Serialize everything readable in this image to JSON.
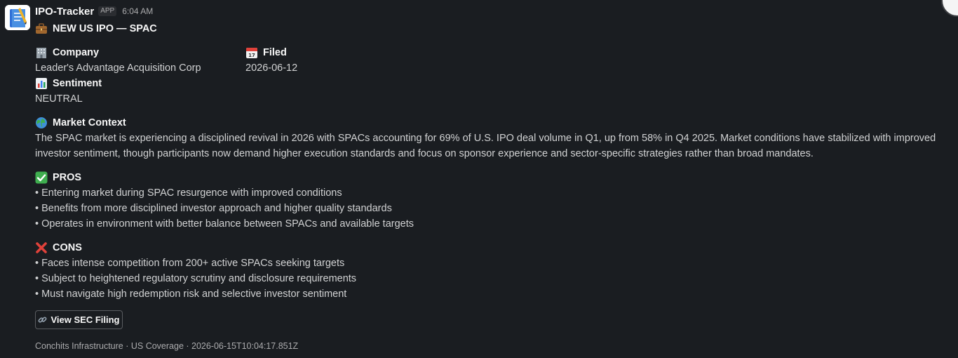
{
  "header": {
    "app_name": "IPO-Tracker",
    "badge": "APP",
    "time": "6:04 AM"
  },
  "title": {
    "icon": "briefcase-icon",
    "text": "NEW US IPO — SPAC"
  },
  "fields": {
    "company": {
      "icon": "office-building-icon",
      "label": "Company",
      "value": "Leader's Advantage Acquisition Corp"
    },
    "filed": {
      "icon": "calendar-icon",
      "label": "Filed",
      "value": "2026-06-12"
    },
    "sentiment": {
      "icon": "bar-chart-icon",
      "label": "Sentiment",
      "value": "NEUTRAL"
    }
  },
  "market_context": {
    "icon": "globe-icon",
    "label": "Market Context",
    "text": "The SPAC market is experiencing a disciplined revival in 2026 with SPACs accounting for 69% of U.S. IPO deal volume in Q1, up from 58% in Q4 2025. Market conditions have stabilized with improved investor sentiment, though participants now demand higher execution standards and focus on sponsor experience and sector-specific strategies rather than broad mandates."
  },
  "pros": {
    "icon": "check-mark-icon",
    "label": "PROS",
    "items": [
      "• Entering market during SPAC resurgence with improved conditions",
      "• Benefits from more disciplined investor approach and higher quality standards",
      "• Operates in environment with better balance between SPACs and available targets"
    ]
  },
  "cons": {
    "icon": "cross-mark-icon",
    "label": "CONS",
    "items": [
      "• Faces intense competition from 200+ active SPACs seeking targets",
      "• Subject to heightened regulatory scrutiny and disclosure requirements",
      "• Must navigate high redemption risk and selective investor sentiment"
    ]
  },
  "button": {
    "icon": "link-icon",
    "label": "View SEC Filing"
  },
  "footer": {
    "text": "Conchits Infrastructure · US Coverage · 2026-06-15T10:04:17.851Z"
  },
  "colors": {
    "background": "#1a1d21",
    "text": "#d1d2d3",
    "heading": "#f8f8f8",
    "muted": "#ababad"
  }
}
